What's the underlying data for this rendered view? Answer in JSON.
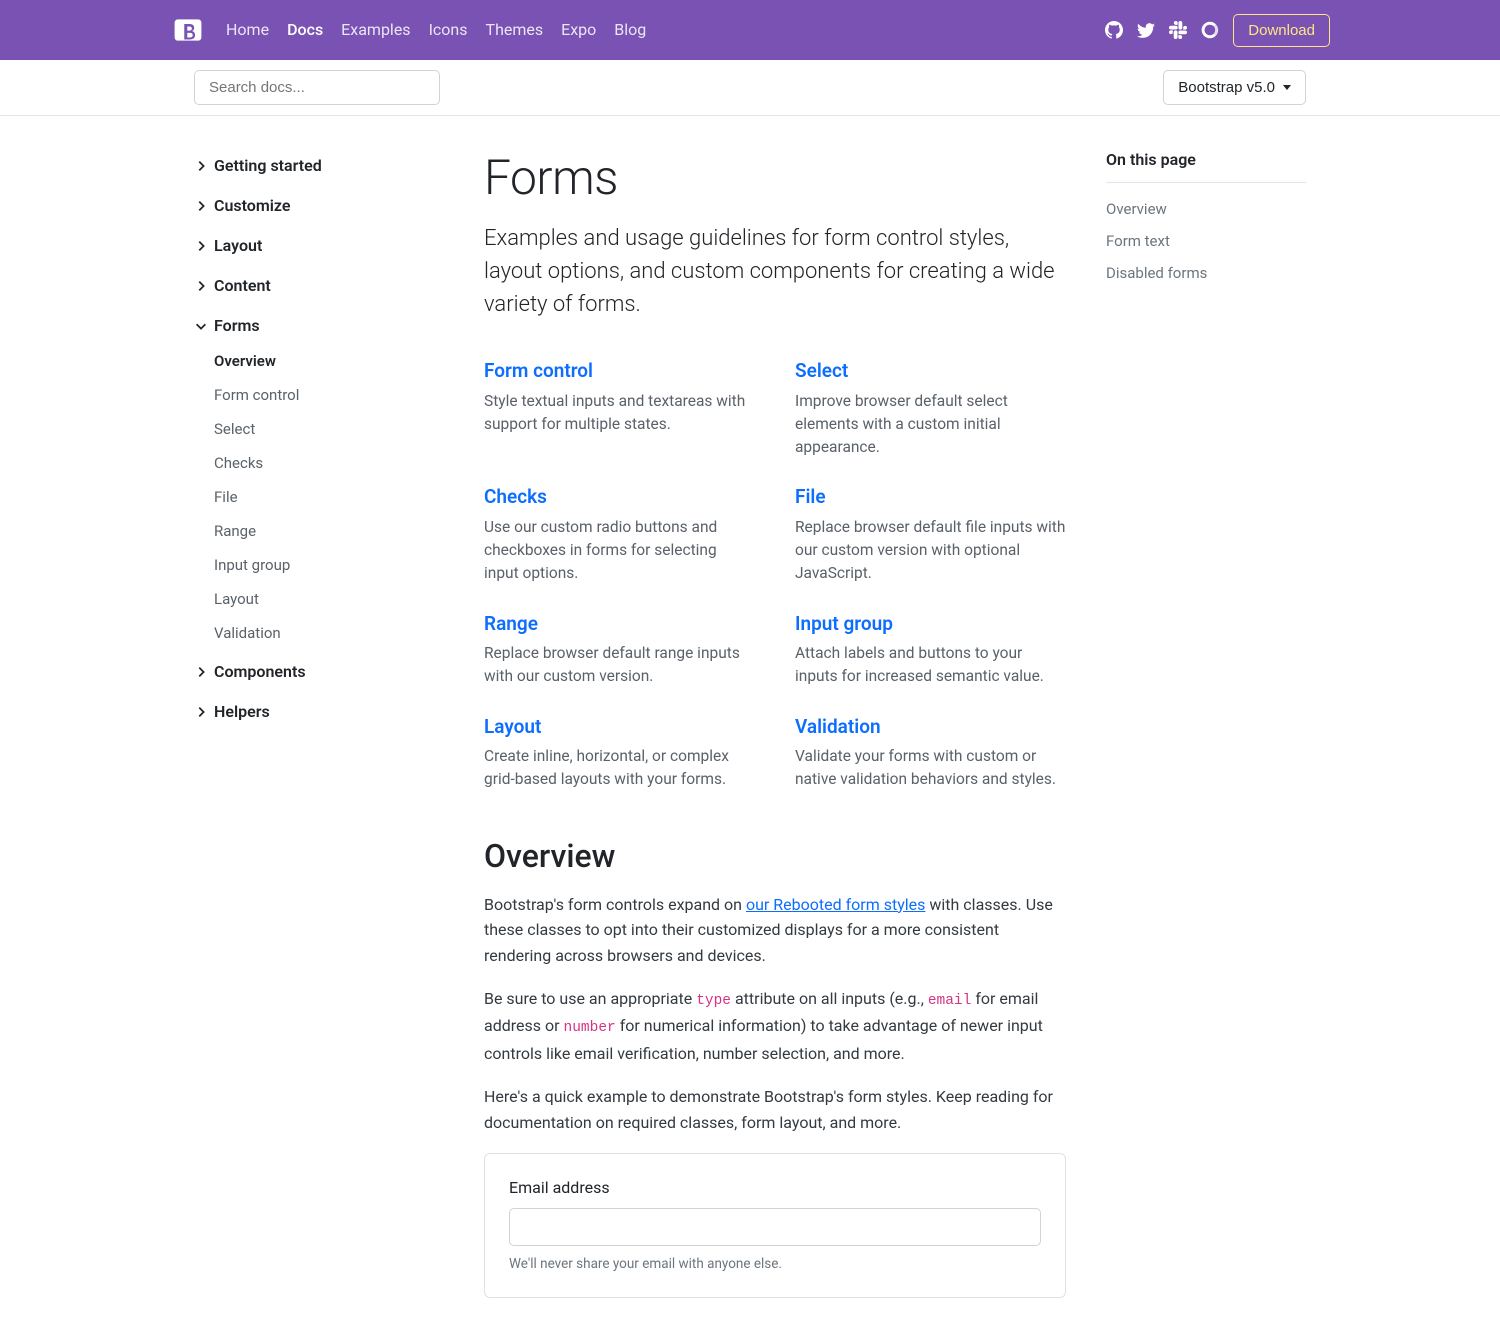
{
  "navbar": {
    "items": [
      "Home",
      "Docs",
      "Examples",
      "Icons",
      "Themes",
      "Expo",
      "Blog"
    ],
    "active_index": 1,
    "download": "Download"
  },
  "subnav": {
    "search_placeholder": "Search docs...",
    "version_label": "Bootstrap v5.0"
  },
  "sidebar": {
    "groups": [
      {
        "label": "Getting started",
        "expanded": false
      },
      {
        "label": "Customize",
        "expanded": false
      },
      {
        "label": "Layout",
        "expanded": false
      },
      {
        "label": "Content",
        "expanded": false
      },
      {
        "label": "Forms",
        "expanded": true,
        "items": [
          {
            "label": "Overview",
            "active": true
          },
          {
            "label": "Form control"
          },
          {
            "label": "Select"
          },
          {
            "label": "Checks"
          },
          {
            "label": "File"
          },
          {
            "label": "Range"
          },
          {
            "label": "Input group"
          },
          {
            "label": "Layout"
          },
          {
            "label": "Validation"
          }
        ]
      },
      {
        "label": "Components",
        "expanded": false
      },
      {
        "label": "Helpers",
        "expanded": false
      }
    ]
  },
  "content": {
    "title": "Forms",
    "lead": "Examples and usage guidelines for form control styles, layout options, and custom components for creating a wide variety of forms.",
    "cards": [
      {
        "title": "Form control",
        "desc": "Style textual inputs and textareas with support for multiple states."
      },
      {
        "title": "Select",
        "desc": "Improve browser default select elements with a custom initial appearance."
      },
      {
        "title": "Checks",
        "desc": "Use our custom radio buttons and checkboxes in forms for selecting input options."
      },
      {
        "title": "File",
        "desc": "Replace browser default file inputs with our custom version with optional JavaScript."
      },
      {
        "title": "Range",
        "desc": "Replace browser default range inputs with our custom version."
      },
      {
        "title": "Input group",
        "desc": "Attach labels and buttons to your inputs for increased semantic value."
      },
      {
        "title": "Layout",
        "desc": "Create inline, horizontal, or complex grid-based layouts with your forms."
      },
      {
        "title": "Validation",
        "desc": "Validate your forms with custom or native validation behaviors and styles."
      }
    ],
    "overview_heading": "Overview",
    "overview_p1_a": "Bootstrap's form controls expand on ",
    "overview_p1_link": "our Rebooted form styles",
    "overview_p1_b": " with classes. Use these classes to opt into their customized displays for a more consistent rendering across browsers and devices.",
    "overview_p2_a": "Be sure to use an appropriate ",
    "overview_p2_code1": "type",
    "overview_p2_b": " attribute on all inputs (e.g., ",
    "overview_p2_code2": "email",
    "overview_p2_c": " for email address or ",
    "overview_p2_code3": "number",
    "overview_p2_d": " for numerical information) to take advantage of newer input controls like email verification, number selection, and more.",
    "overview_p3": "Here's a quick example to demonstrate Bootstrap's form styles. Keep reading for documentation on required classes, form layout, and more.",
    "example": {
      "email_label": "Email address",
      "email_help": "We'll never share your email with anyone else."
    }
  },
  "toc": {
    "title": "On this page",
    "items": [
      "Overview",
      "Form text",
      "Disabled forms"
    ]
  }
}
